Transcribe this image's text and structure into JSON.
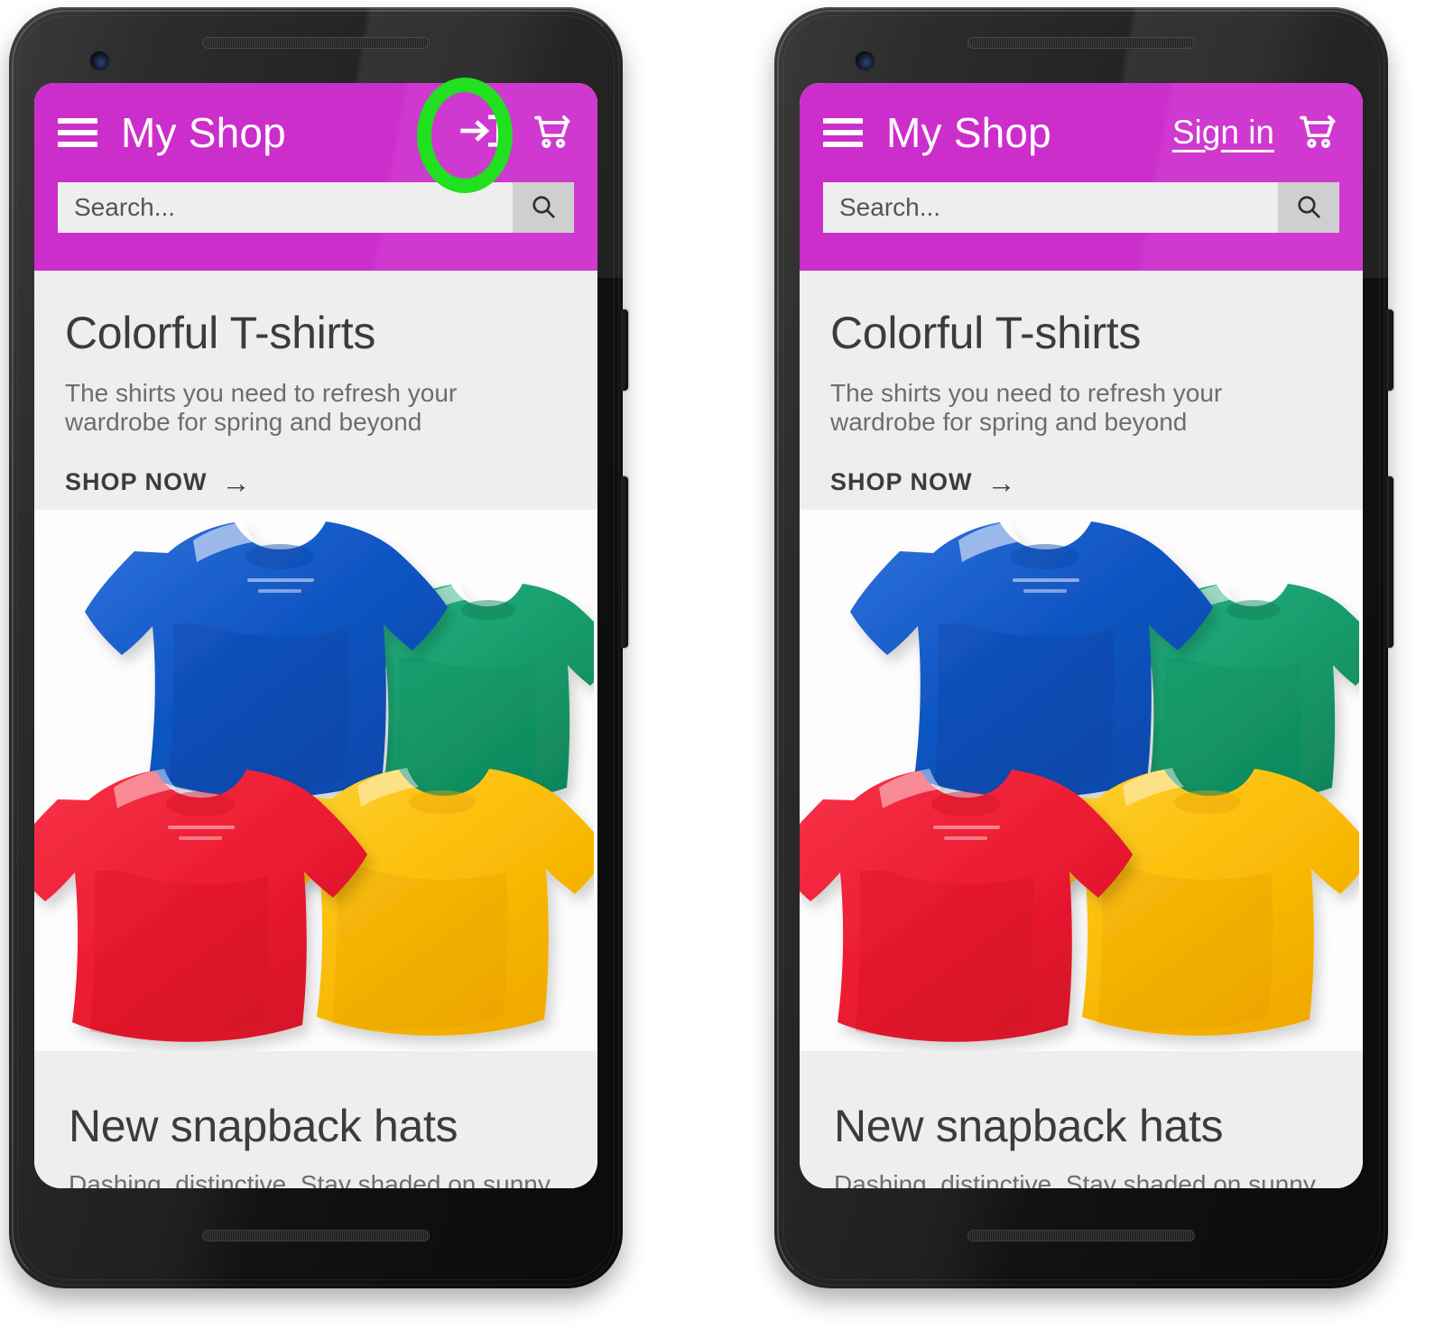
{
  "screenshot": {
    "description": "Two Android phone mockups side by side showing the 'My Shop' mobile web app; a green highlight circle marks the account/sign-in control in the app bar of each."
  },
  "colors": {
    "app_bar": "#CC2ECC",
    "highlight_circle": "#20E020",
    "content_background": "#EEEEEE",
    "heading_text": "#3C3C3C",
    "body_text": "#6D6D6D",
    "search_field": "#EEEEEE",
    "search_button": "#CFCFCF",
    "shirt_blue": "#1156C4",
    "shirt_green": "#179C6B",
    "shirt_red": "#EE1C32",
    "shirt_yellow": "#FBBE08"
  },
  "phones": [
    {
      "id": "left-phone",
      "variant": "icon",
      "app_bar": {
        "menu_icon": "hamburger-menu-icon",
        "title": "My Shop",
        "account_icon": "login-arrow-icon",
        "account_label": "",
        "cart_icon": "shopping-cart-icon"
      },
      "search": {
        "placeholder": "Search...",
        "value": "",
        "button_icon": "search-magnifier-icon"
      },
      "hero": {
        "title": "Colorful T-shirts",
        "subtitle": "The shirts you need to refresh your wardrobe for spring and beyond",
        "cta_label": "SHOP NOW",
        "cta_arrow": "→",
        "image_alt": "Four folded t-shirts: blue, green, red and yellow"
      },
      "section_2": {
        "title": "New snapback hats",
        "subtitle": "Dashing, distinctive. Stay shaded on sunny"
      },
      "highlight": {
        "shape": "oval",
        "target": "login-arrow-icon"
      }
    },
    {
      "id": "right-phone",
      "variant": "text",
      "app_bar": {
        "menu_icon": "hamburger-menu-icon",
        "title": "My Shop",
        "account_icon": "",
        "account_label": "Sign in",
        "cart_icon": "shopping-cart-icon"
      },
      "search": {
        "placeholder": "Search...",
        "value": "",
        "button_icon": "search-magnifier-icon"
      },
      "hero": {
        "title": "Colorful T-shirts",
        "subtitle": "The shirts you need to refresh your wardrobe for spring and beyond",
        "cta_label": "SHOP NOW",
        "cta_arrow": "→",
        "image_alt": "Four folded t-shirts: blue, green, red and yellow"
      },
      "section_2": {
        "title": "New snapback hats",
        "subtitle": "Dashing, distinctive. Stay shaded on sunny"
      },
      "highlight": {
        "shape": "round",
        "target": "sign-in-link"
      }
    }
  ]
}
